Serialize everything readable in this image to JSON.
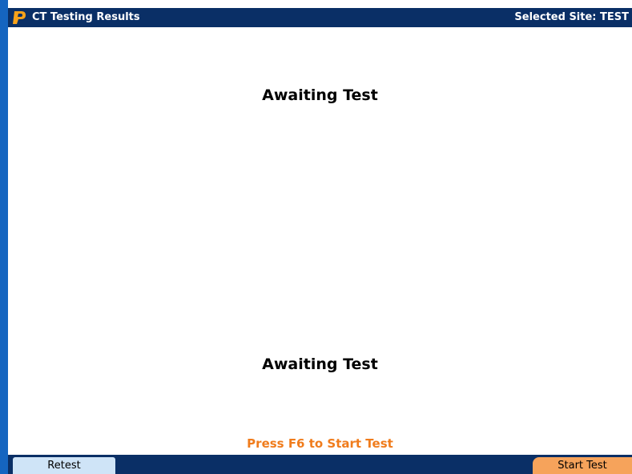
{
  "header": {
    "title": "CT Testing Results",
    "site": "Selected Site: TEST",
    "logo_icon": "p-logo-icon",
    "background_color": "#0a2f66"
  },
  "main": {
    "status_top": "Awaiting Test",
    "status_bottom": "Awaiting Test",
    "prompt": "Press F6 to Start Test",
    "prompt_color": "#f07c1c"
  },
  "softkeys": {
    "retest_label": "Retest",
    "start_test_label": "Start Test",
    "retest_color": "#cfe4f7",
    "start_test_color": "#f6a35b"
  }
}
